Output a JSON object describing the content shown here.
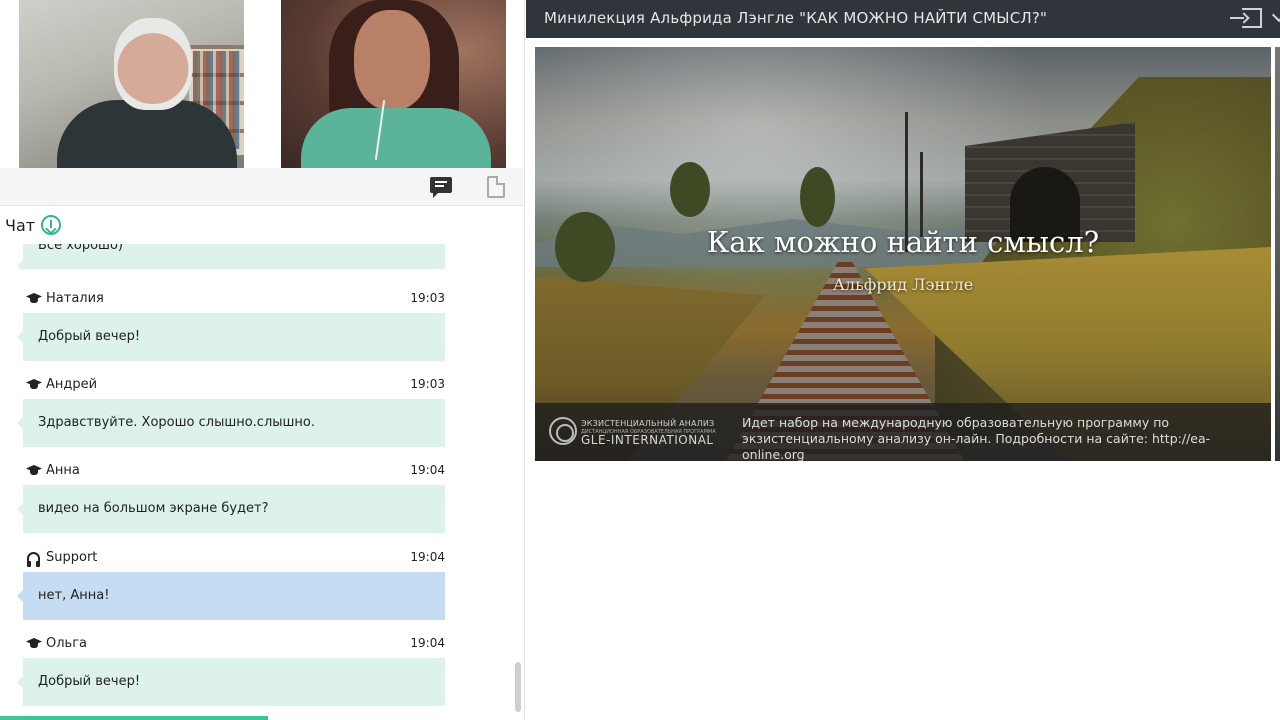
{
  "chat": {
    "title": "Чат",
    "partial_message": "Все хорошо)",
    "messages": [
      {
        "author": "Наталия",
        "time": "19:03",
        "text": "Добрый вечер!",
        "role": "student"
      },
      {
        "author": "Андрей",
        "time": "19:03",
        "text": "Здравствуйте. Хорошо слышно.слышно.",
        "role": "student"
      },
      {
        "author": "Анна",
        "time": "19:04",
        "text": "видео на большом экране будет?",
        "role": "student"
      },
      {
        "author": "Support",
        "time": "19:04",
        "text": "нет, Анна!",
        "role": "support"
      },
      {
        "author": "Ольга",
        "time": "19:04",
        "text": "Добрый вечер!",
        "role": "student"
      }
    ]
  },
  "presentation": {
    "title": "Минилекция Альфрида Лэнгле \"КАК МОЖНО НАЙТИ СМЫСЛ?\"",
    "slide_title": "Как можно найти смысл?",
    "slide_subtitle": "Альфрид Лэнгле",
    "brand_small": "ЭКЗИСТЕНЦИАЛЬНЫЙ АНАЛИЗ",
    "brand_tiny": "ДИСТАНЦИОННАЯ ОБРАЗОВАТЕЛЬНАЯ ПРОГРАММА",
    "brand_name": "GLE-INTERNATIONAL",
    "notice": "Идет набор на международную образовательную программу по экзистенциальному анализу он-лайн. Подробности на сайте: http://ea-online.org"
  },
  "colors": {
    "accent": "#3cc49a",
    "message_bg": "#ddf3ea",
    "support_bg": "#c6dcf2",
    "header_bg": "#2f353a"
  },
  "icons": [
    "chat-icon",
    "document-icon",
    "download-icon",
    "graduation-cap-icon",
    "headset-icon",
    "exit-icon",
    "chevron-down-icon"
  ]
}
